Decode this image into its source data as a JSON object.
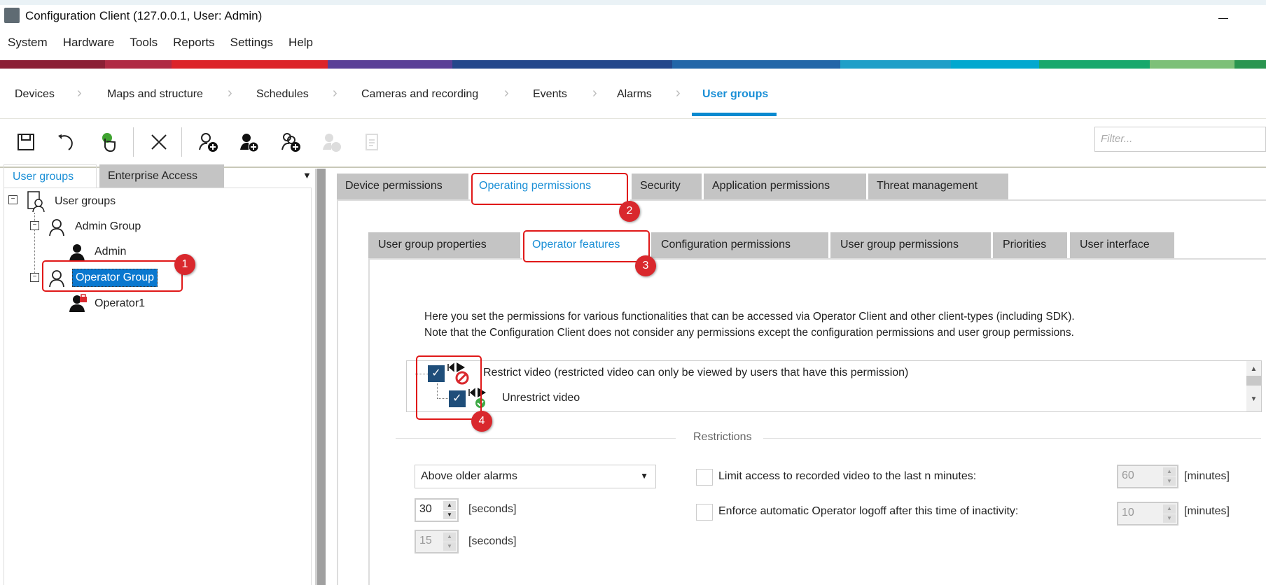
{
  "window": {
    "title": "Configuration Client (127.0.0.1, User: Admin)",
    "minimize": "—"
  },
  "menu": [
    "System",
    "Hardware",
    "Tools",
    "Reports",
    "Settings",
    "Help"
  ],
  "nav": {
    "items": [
      "Devices",
      "Maps and structure",
      "Schedules",
      "Cameras and recording",
      "Events",
      "Alarms",
      "User groups"
    ],
    "active": "User groups",
    "separator": "›"
  },
  "brand_band": [
    "#8b1f35",
    "#b02a44",
    "#dc2329",
    "#5a3f97",
    "#23478b",
    "#2266a8",
    "#1e9fc8",
    "#02a8cf",
    "#18a86c",
    "#7dc078",
    "#2a9550"
  ],
  "toolbar": {
    "icons": [
      "save-icon",
      "undo-icon",
      "activate-icon",
      "delete-icon",
      "add-user-group-icon",
      "add-user-icon",
      "add-dual-group-icon",
      "add-enterprise-group-icon",
      "copy-icon"
    ],
    "filter_placeholder": "Filter..."
  },
  "left": {
    "tabs": [
      "User groups",
      "Enterprise Access"
    ],
    "dropdown": "▼",
    "tree": [
      {
        "label": "User groups"
      },
      {
        "label": "Admin Group"
      },
      {
        "label": "Admin"
      },
      {
        "label": "Operator Group",
        "selected": true
      },
      {
        "label": "Operator1",
        "locked": true
      }
    ]
  },
  "outer_tabs": [
    "Device permissions",
    "Operating permissions",
    "Security",
    "Application permissions",
    "Threat management"
  ],
  "inner_tabs": [
    "User group properties",
    "Operator features",
    "Configuration permissions",
    "User group permissions",
    "Priorities",
    "User interface"
  ],
  "content": {
    "desc1": "Here you set the permissions for various functionalities that can be accessed via Operator Client and other client-types (including SDK).",
    "desc2": "Note that the Configuration Client does not consider any permissions except the configuration permissions and user group permissions.",
    "permissions": [
      {
        "label": "Restrict video (restricted video can only be viewed by users that have this permission)",
        "checked": true
      },
      {
        "label": "Unrestrict video",
        "checked": true
      }
    ],
    "restrictions_label": "Restrictions",
    "alarm_order": "Above older alarms",
    "spin1": {
      "value": "30",
      "unit": "[seconds]"
    },
    "spin2": {
      "value": "15",
      "unit": "[seconds]"
    },
    "limit": {
      "label": "Limit access to recorded video to the last n minutes:",
      "checked": false,
      "value": "60",
      "unit": "[minutes]"
    },
    "logoff": {
      "label": "Enforce automatic Operator logoff after this time of inactivity:",
      "checked": false,
      "value": "10",
      "unit": "[minutes]"
    }
  },
  "annotations": [
    "1",
    "2",
    "3",
    "4"
  ],
  "colors": {
    "accent": "#1a8fd6",
    "annotation": "#e01818",
    "checkbox": "#1f4e7a"
  }
}
